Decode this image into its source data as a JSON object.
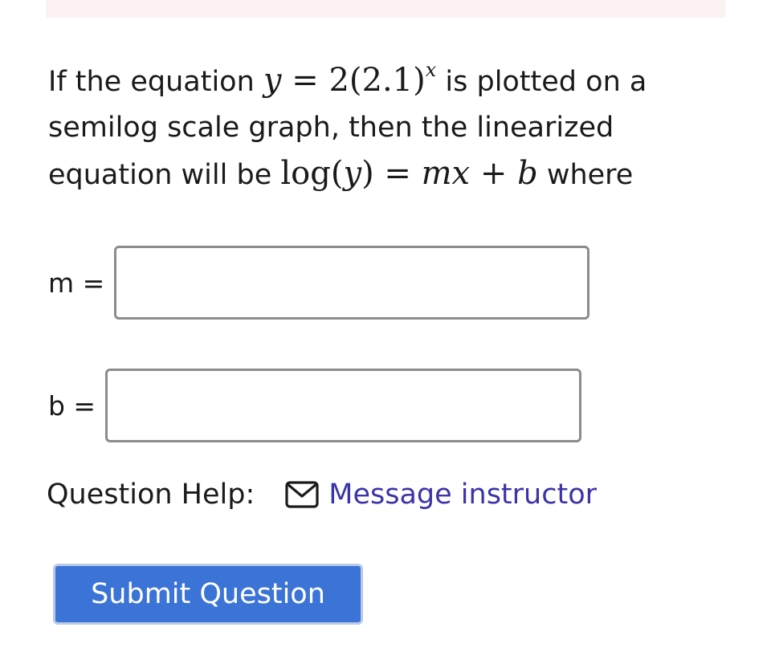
{
  "question": {
    "line1_pre": "If the equation ",
    "eq1_y": "y",
    "eq1_eq": " = 2(2.1)",
    "eq1_exp": "x",
    "line1_post": " is plotted on a",
    "line2": "semilog scale graph, then the linearized",
    "line3_pre": "equation will be ",
    "eq2_log": "log(",
    "eq2_y": "y",
    "eq2_close": ") = ",
    "eq2_m": "mx",
    "eq2_plus": " + ",
    "eq2_b": "b",
    "line3_post": " where"
  },
  "fields": {
    "m_label": "m = ",
    "m_value": "",
    "b_label": "b = ",
    "b_value": ""
  },
  "help": {
    "label": "Question Help:",
    "icon": "envelope-icon",
    "link_text": "Message instructor",
    "link_color": "#3a34a8"
  },
  "submit": {
    "label": "Submit Question",
    "color": "#3b73d6"
  },
  "colors": {
    "top_strip": "#fdf2f2"
  }
}
